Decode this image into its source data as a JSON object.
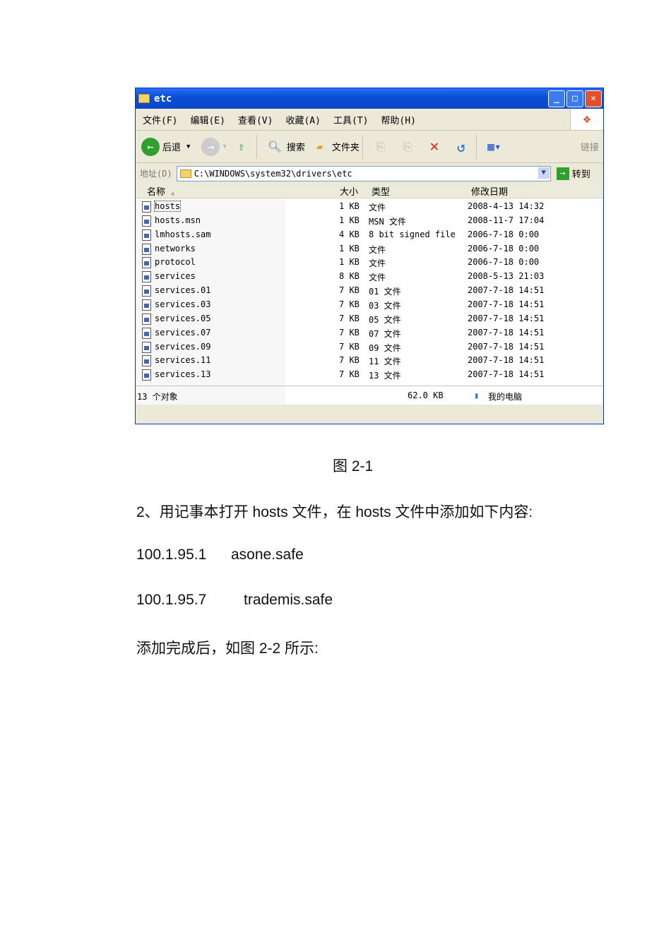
{
  "window": {
    "title": "etc",
    "menu": [
      "文件(F)",
      "编辑(E)",
      "查看(V)",
      "收藏(A)",
      "工具(T)",
      "帮助(H)"
    ],
    "toolbar": {
      "back": "后退",
      "search": "搜索",
      "folders": "文件夹",
      "links": "链接"
    },
    "address": {
      "label": "地址(D)",
      "value": "C:\\WINDOWS\\system32\\drivers\\etc",
      "go": "转到"
    },
    "columns": {
      "name": "名称",
      "size": "大小",
      "type": "类型",
      "date": "修改日期"
    },
    "files": [
      {
        "name": "hosts",
        "size": "1 KB",
        "type": "文件",
        "date": "2008-4-13 14:32"
      },
      {
        "name": "hosts.msn",
        "size": "1 KB",
        "type": "MSN 文件",
        "date": "2008-11-7 17:04"
      },
      {
        "name": "lmhosts.sam",
        "size": "4 KB",
        "type": "8 bit signed file",
        "date": "2006-7-18 0:00"
      },
      {
        "name": "networks",
        "size": "1 KB",
        "type": "文件",
        "date": "2006-7-18 0:00"
      },
      {
        "name": "protocol",
        "size": "1 KB",
        "type": "文件",
        "date": "2006-7-18 0:00"
      },
      {
        "name": "services",
        "size": "8 KB",
        "type": "文件",
        "date": "2008-5-13 21:03"
      },
      {
        "name": "services.01",
        "size": "7 KB",
        "type": "01 文件",
        "date": "2007-7-18 14:51"
      },
      {
        "name": "services.03",
        "size": "7 KB",
        "type": "03 文件",
        "date": "2007-7-18 14:51"
      },
      {
        "name": "services.05",
        "size": "7 KB",
        "type": "05 文件",
        "date": "2007-7-18 14:51"
      },
      {
        "name": "services.07",
        "size": "7 KB",
        "type": "07 文件",
        "date": "2007-7-18 14:51"
      },
      {
        "name": "services.09",
        "size": "7 KB",
        "type": "09 文件",
        "date": "2007-7-18 14:51"
      },
      {
        "name": "services.11",
        "size": "7 KB",
        "type": "11 文件",
        "date": "2007-7-18 14:51"
      },
      {
        "name": "services.13",
        "size": "7 KB",
        "type": "13 文件",
        "date": "2007-7-18 14:51"
      }
    ],
    "status": {
      "count": "13 个对象",
      "size": "62.0 KB",
      "location": "我的电脑"
    }
  },
  "doc": {
    "caption": "图 2-1",
    "para1": "2、用记事本打开 hosts 文件，在 hosts 文件中添加如下内容:",
    "line1_ip": "100.1.95.1",
    "line1_host": "asone.safe",
    "line2_ip": "100.1.95.7",
    "line2_host": "trademis.safe",
    "para2": "添加完成后，如图 2-2 所示:"
  }
}
